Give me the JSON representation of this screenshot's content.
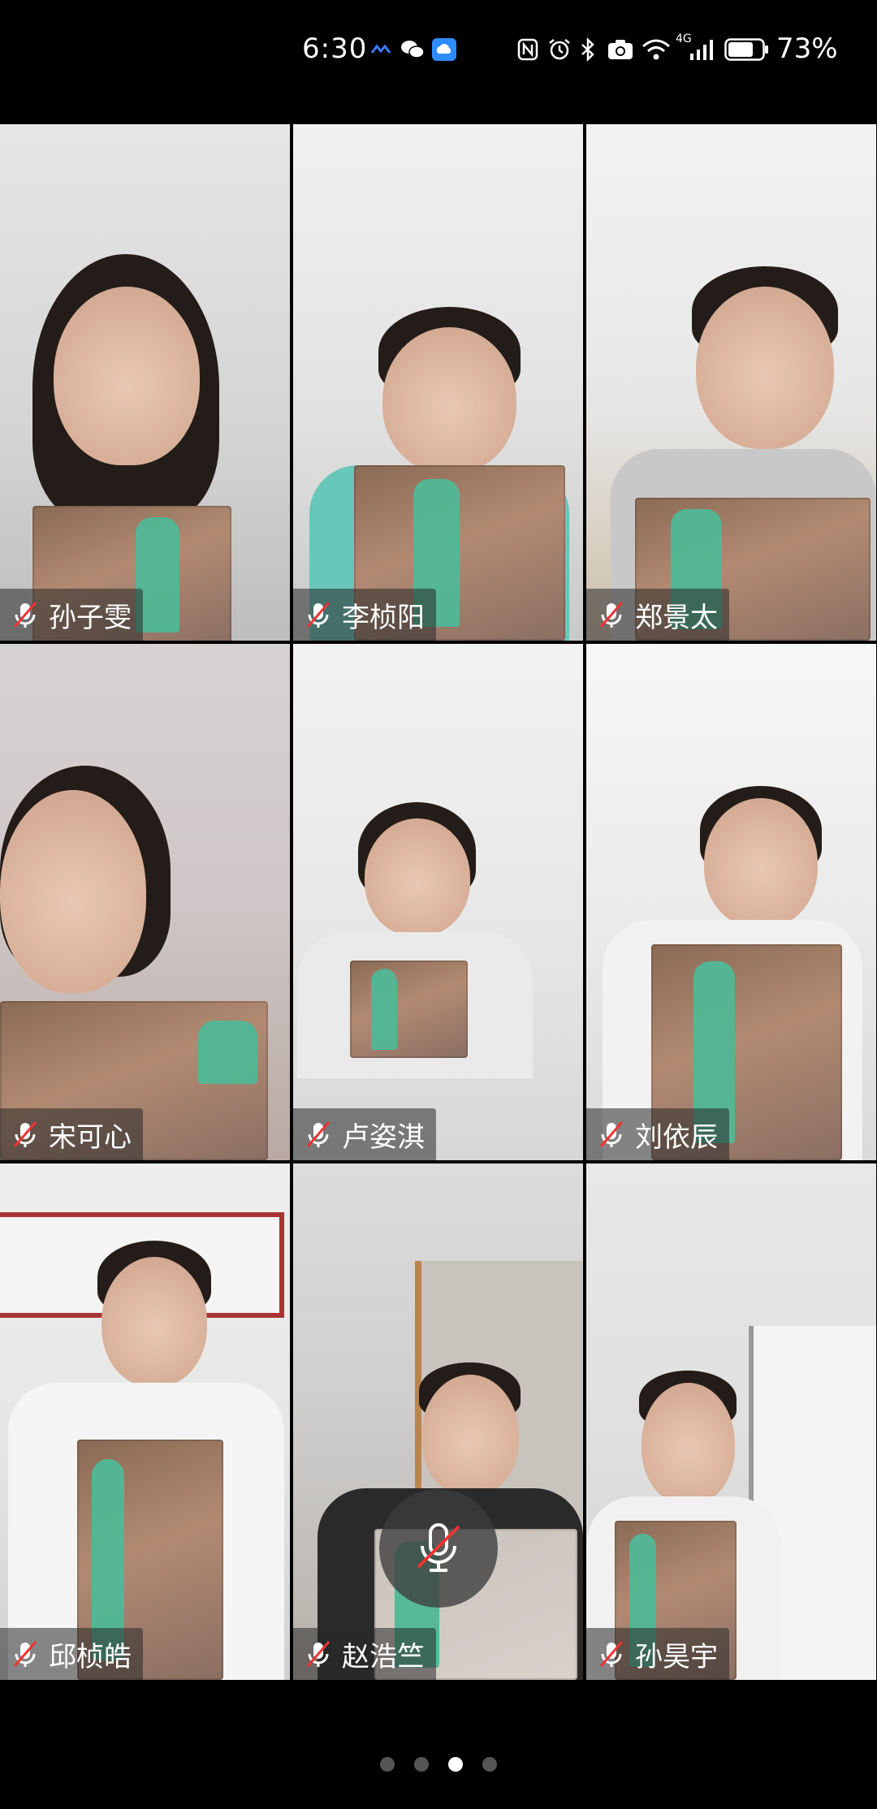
{
  "status_bar": {
    "time": "6:30",
    "network": "4G",
    "battery_percent": "73%",
    "icons": [
      "baidu-netdisk-icon",
      "wechat-icon",
      "cloud-icon",
      "nfc-icon",
      "alarm-icon",
      "bluetooth-icon",
      "camera-icon",
      "wifi-icon",
      "signal-icon",
      "battery-icon"
    ]
  },
  "participants": [
    {
      "name": "孙子雯",
      "muted": true
    },
    {
      "name": "李桢阳",
      "muted": true
    },
    {
      "name": "郑景太",
      "muted": true
    },
    {
      "name": "宋可心",
      "muted": true
    },
    {
      "name": "卢姿淇",
      "muted": true
    },
    {
      "name": "刘依辰",
      "muted": true
    },
    {
      "name": "邱桢皓",
      "muted": true
    },
    {
      "name": "赵浩竺",
      "muted": true
    },
    {
      "name": "孙昊宇",
      "muted": true
    }
  ],
  "controls": {
    "mic_muted": true,
    "mic_icon": "mic-off-icon"
  },
  "pagination": {
    "pages": 4,
    "current_page": 3
  },
  "colors": {
    "background": "#000000",
    "book_spine": "#4fb896",
    "tag_bg": "rgba(40,40,40,0.55)"
  }
}
